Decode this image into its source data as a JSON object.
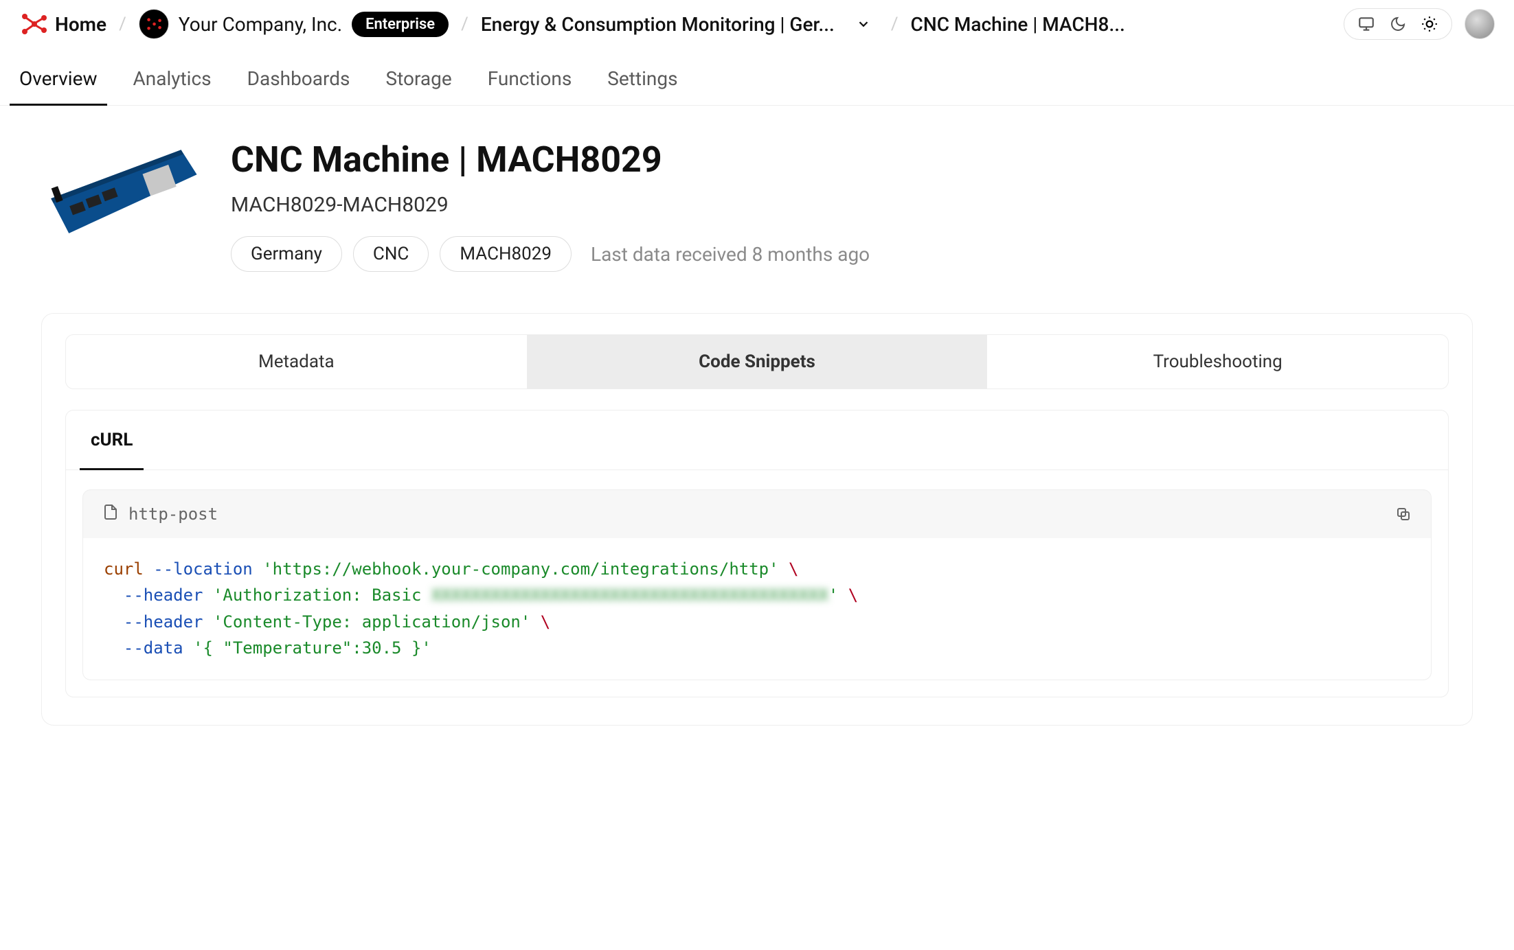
{
  "breadcrumb": {
    "home_label": "Home",
    "org_name": "Your Company, Inc.",
    "org_badge": "Enterprise",
    "project_label": "Energy & Consumption Monitoring | Ger...",
    "device_label": "CNC Machine | MACH8..."
  },
  "nav_tabs": {
    "items": [
      "Overview",
      "Analytics",
      "Dashboards",
      "Storage",
      "Functions",
      "Settings"
    ],
    "active_index": 0
  },
  "device": {
    "title": "CNC Machine | MACH8029",
    "subtitle": "MACH8029-MACH8029",
    "chips": [
      "Germany",
      "CNC",
      "MACH8029"
    ],
    "last_data": "Last data received 8 months ago"
  },
  "panel": {
    "seg_tabs": [
      "Metadata",
      "Code Snippets",
      "Troubleshooting"
    ],
    "seg_active_index": 1,
    "code_subtabs": [
      "cURL"
    ],
    "code_sub_active_index": 0,
    "code_title": "http-post",
    "code": {
      "cmd": "curl",
      "flags": {
        "location": "--location",
        "header": "--header",
        "data": "--data"
      },
      "url": "'https://webhook.your-company.com/integrations/http'",
      "auth_prefix": "'Authorization: Basic ",
      "auth_secret_masked": "XXXXXXXXXXXXXXXXXXXXXXXXXXXXXXXXXXXXXXXX",
      "auth_suffix": "'",
      "content_type": "'Content-Type: application/json'",
      "data_body": "'{ \"Temperature\":30.5 }'",
      "cont": "\\"
    }
  },
  "icons": {
    "chevron_down": "chevron-down-icon",
    "monitor": "monitor-icon",
    "moon": "moon-icon",
    "sun": "sun-icon",
    "file": "file-icon",
    "copy": "copy-icon"
  }
}
